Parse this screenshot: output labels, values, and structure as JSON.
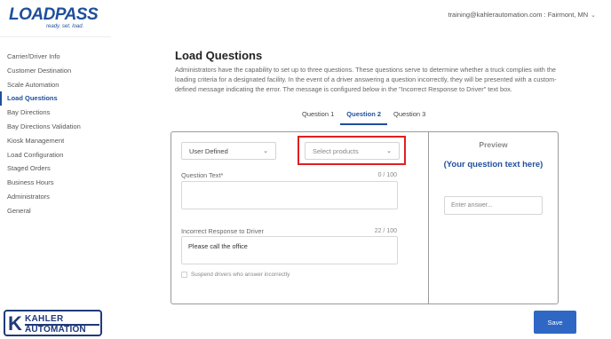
{
  "brand": {
    "name": "LOADPASS",
    "tagline": "ready. set. load."
  },
  "account": {
    "label": "training@kahlerautomation.com : Fairmont, MN"
  },
  "sidebar": {
    "items": [
      {
        "label": "Carrier/Driver Info"
      },
      {
        "label": "Customer Destination"
      },
      {
        "label": "Scale Automation"
      },
      {
        "label": "Load Questions",
        "active": true
      },
      {
        "label": "Bay Directions"
      },
      {
        "label": "Bay Directions Validation"
      },
      {
        "label": "Kiosk Management"
      },
      {
        "label": "Load Configuration"
      },
      {
        "label": "Staged Orders"
      },
      {
        "label": "Business Hours"
      },
      {
        "label": "Administrators"
      },
      {
        "label": "General"
      }
    ]
  },
  "footer_logo": {
    "letter": "K",
    "top": "KAHLER",
    "bottom": "AUTOMATION"
  },
  "main": {
    "title": "Load Questions",
    "description": "Administrators have the capability to set up to three questions. These questions serve to determine whether a truck complies with the loading criteria for a designated facility. In the event of a driver answering a question incorrectly, they will be presented with a custom-defined message indicating the error. The message is configured below in the \"Incorrect Response to Driver\" text box.",
    "tabs": [
      {
        "label": "Question 1"
      },
      {
        "label": "Question 2",
        "active": true
      },
      {
        "label": "Question 3"
      }
    ]
  },
  "form": {
    "question_type": "User Defined",
    "products_placeholder": "Select products",
    "question_text_label": "Question Text*",
    "question_text_count": "0 / 100",
    "question_text_value": "",
    "incorrect_label": "Incorrect Response to Driver",
    "incorrect_count": "22 / 100",
    "incorrect_value": "Please call the office",
    "suspend_label": "Suspend drivers who answer incorrectly"
  },
  "preview": {
    "title": "Preview",
    "question": "(Your question text here)",
    "answer_placeholder": "Enter answer..."
  },
  "actions": {
    "save": "Save"
  },
  "colors": {
    "brand_blue": "#1f4f9c",
    "save_button": "#2f68c4",
    "highlight_red": "#e0201f"
  }
}
